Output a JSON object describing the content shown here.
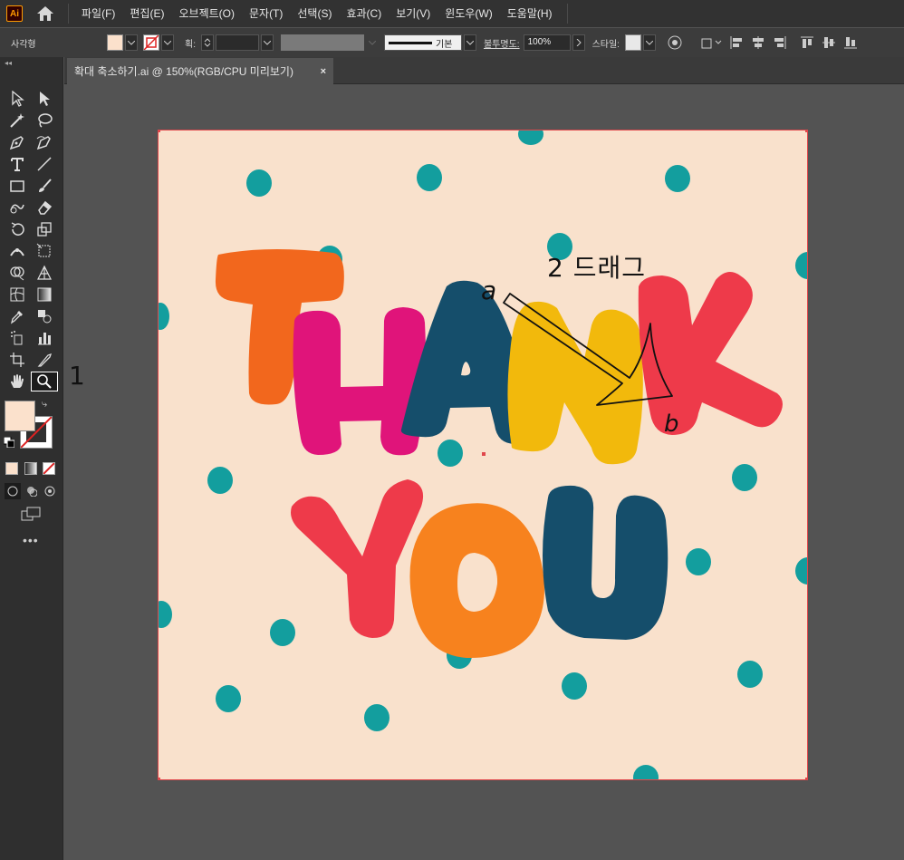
{
  "app": {
    "logo_text": "Ai",
    "accent": "#ff9a00"
  },
  "menu": [
    {
      "label": "파일(F)"
    },
    {
      "label": "편집(E)"
    },
    {
      "label": "오브젝트(O)"
    },
    {
      "label": "문자(T)"
    },
    {
      "label": "선택(S)"
    },
    {
      "label": "효과(C)"
    },
    {
      "label": "보기(V)"
    },
    {
      "label": "윈도우(W)"
    },
    {
      "label": "도움말(H)"
    }
  ],
  "control": {
    "shape_label": "사각형",
    "fill_color": "#fbe1cc",
    "stroke_label": "획:",
    "stroke_profile": "기본",
    "opacity_label": "불투명도:",
    "opacity_value": "100%",
    "style_label": "스타일:"
  },
  "tab": {
    "title": "확대 축소하기.ai @ 150%(RGB/CPU 미리보기)",
    "close": "×"
  },
  "artboard": {
    "background": "#f9e1cc",
    "letters_top": [
      "T",
      "H",
      "A",
      "N",
      "K"
    ],
    "letters_bottom": [
      "Y",
      "O",
      "U"
    ],
    "colors": {
      "T": "#f2671d",
      "H": "#e0147a",
      "A": "#154e6b",
      "N": "#f2b90c",
      "K": "#ee3a4a",
      "Y": "#ee3a4a",
      "O": "#f7821e",
      "U": "#154e6b",
      "dot": "#139e9e"
    }
  },
  "annotations": {
    "step1": "1",
    "step2": "2 드래그",
    "point_a": "a",
    "point_b": "b"
  }
}
